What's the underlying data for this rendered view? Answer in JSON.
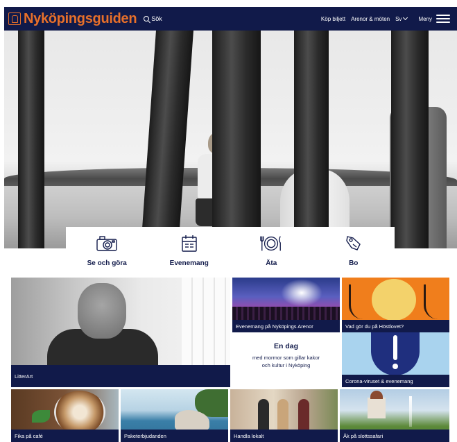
{
  "header": {
    "logo_text": "Nyköpingsguiden",
    "search_label": "Sök",
    "buy_ticket": "Köp biljett",
    "venues": "Arenor & möten",
    "language": "Sv",
    "menu_label": "Meny"
  },
  "categories": [
    {
      "label": "Se och göra",
      "icon": "camera-icon"
    },
    {
      "label": "Evenemang",
      "icon": "calendar-icon"
    },
    {
      "label": "Äta",
      "icon": "plate-cutlery-icon"
    },
    {
      "label": "Bo",
      "icon": "key-icon"
    }
  ],
  "tiles": {
    "litterart": "LitterArt",
    "arenor": "Evenemang på Nyköpings Arenor",
    "hostlov": "Vad gör du på Höstlovet?",
    "endag_title": "En dag",
    "endag_text": "med mormor som gillar kakor och kultur i Nyköping",
    "corona": "Corona-viruset & evenemang",
    "fika": "Fika på café",
    "paket": "Paketerbjudanden",
    "handla": "Handla lokalt",
    "slott": "Åk på slottssafari"
  },
  "colors": {
    "navy": "#111a4a",
    "brand_orange": "#e8702a",
    "autumn_orange": "#f07e1c",
    "corona_blue": "#a9d3ee"
  }
}
